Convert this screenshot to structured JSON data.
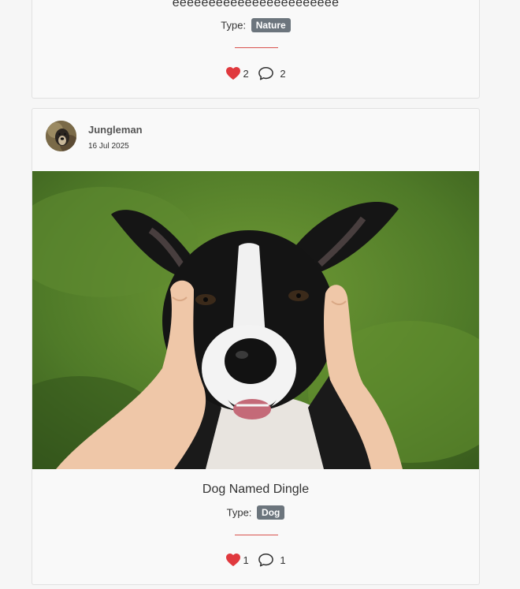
{
  "posts": [
    {
      "title": "eeeeeeeeeeeeeeeeeeeeeee",
      "type_label": "Type:",
      "type_value": "Nature",
      "likes": "2",
      "comments": "2"
    },
    {
      "author": "Jungleman",
      "date": "16 Jul 2025",
      "title": "Dog Named Dingle",
      "type_label": "Type:",
      "type_value": "Dog",
      "likes": "1",
      "comments": "1"
    }
  ],
  "icons": {
    "like": "heart-icon",
    "comment": "comment-bubble-icon"
  },
  "colors": {
    "heart": "#e0393e",
    "divider": "#d9534f",
    "badge": "#6c757d"
  }
}
